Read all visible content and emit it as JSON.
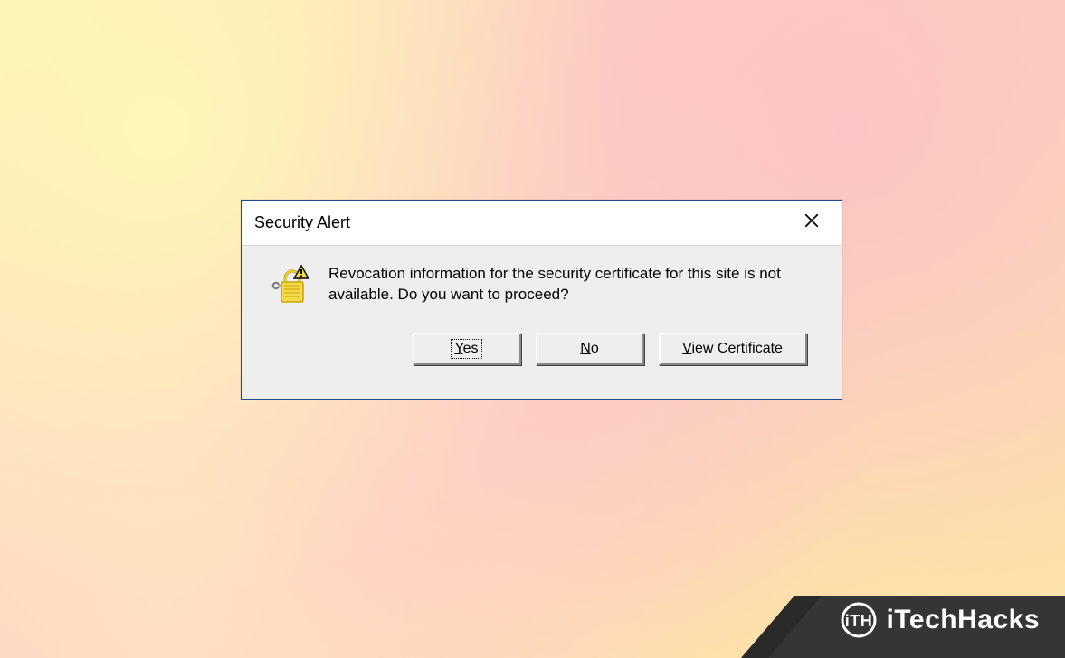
{
  "dialog": {
    "title": "Security Alert",
    "message": "Revocation information for the security certificate for this site is not available. Do you want to proceed?",
    "buttons": {
      "yes": {
        "mnemonic": "Y",
        "rest": "es"
      },
      "no": {
        "mnemonic": "N",
        "rest": "o"
      },
      "view_cert": {
        "mnemonic": "V",
        "rest": "iew Certificate"
      }
    }
  },
  "watermark": {
    "brand": "iTechHacks"
  }
}
